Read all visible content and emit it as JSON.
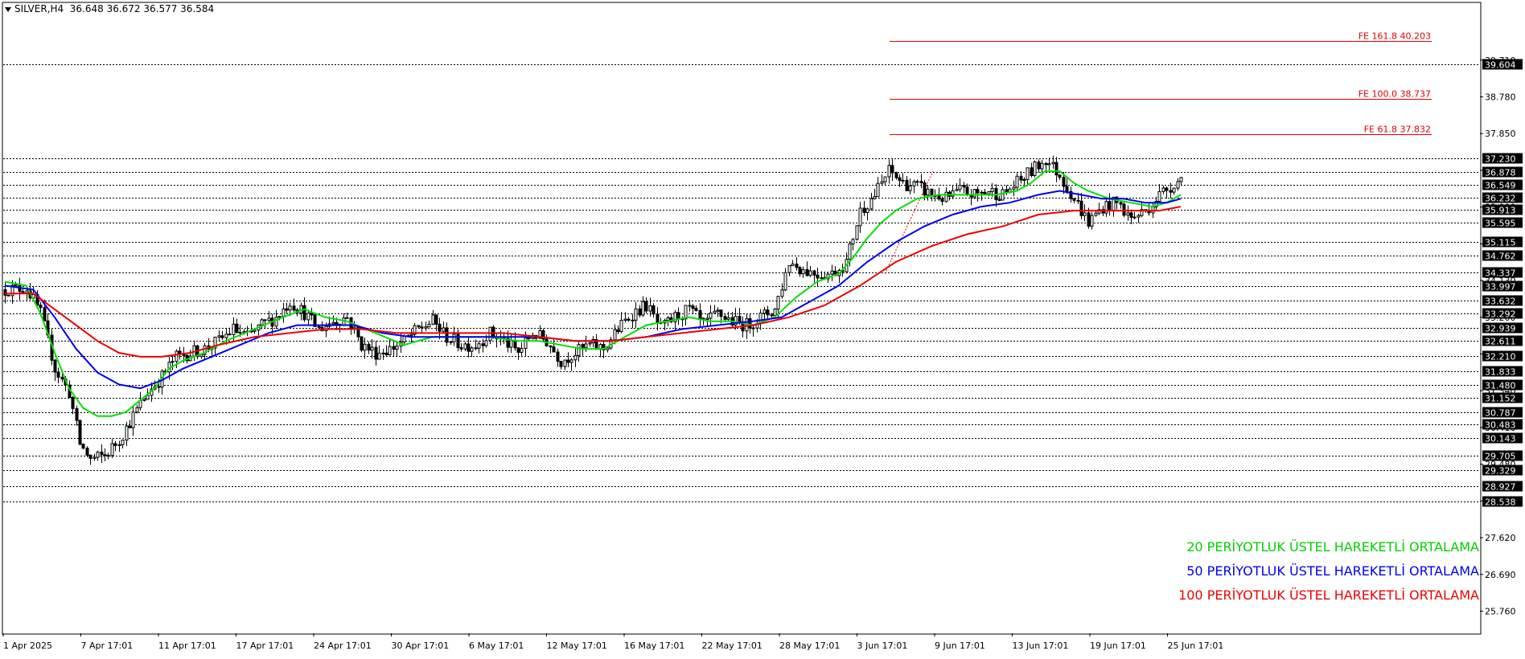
{
  "header": {
    "symbol": "SILVER,H4",
    "ohlc": "36.648 36.672 36.577 36.584"
  },
  "legend": [
    {
      "label": "20 PERİYOTLUK ÜSTEL HAREKETLİ ORTALAMA",
      "color": "#00e000"
    },
    {
      "label": "50 PERİYOTLUK ÜSTEL HAREKETLİ ORTALAMA",
      "color": "#0000ee"
    },
    {
      "label": "100 PERİYOTLUK ÜSTEL HAREKETLİ ORTALAMA",
      "color": "#ee0000"
    }
  ],
  "chart_data": {
    "type": "candlestick",
    "ylim": [
      25.2,
      41.15
    ],
    "y_ticks": [
      "39.710",
      "38.780",
      "37.850",
      "36.920",
      "35.990",
      "35.060",
      "34.130",
      "33.200",
      "32.270",
      "31.340",
      "30.410",
      "29.480",
      "28.550",
      "27.620",
      "26.690",
      "25.760"
    ],
    "x_ticks": [
      "1 Apr 2025",
      "7 Apr 17:01",
      "11 Apr 17:01",
      "17 Apr 17:01",
      "24 Apr 17:01",
      "30 Apr 17:01",
      "6 May 17:01",
      "12 May 17:01",
      "16 May 17:01",
      "22 May 17:01",
      "28 May 17:01",
      "3 Jun 17:01",
      "9 Jun 17:01",
      "13 Jun 17:01",
      "19 Jun 17:01",
      "25 Jun 17:01"
    ],
    "levels": [
      "39.604",
      "37.230",
      "36.878",
      "36.549",
      "36.232",
      "35.913",
      "35.595",
      "35.115",
      "34.762",
      "34.337",
      "33.997",
      "33.632",
      "33.292",
      "32.939",
      "32.611",
      "32.210",
      "31.833",
      "31.480",
      "31.152",
      "30.787",
      "30.483",
      "30.143",
      "29.705",
      "29.329",
      "28.927",
      "28.538"
    ],
    "fibonacci": [
      {
        "label": "FE 161.8 40.203",
        "value": 40.203
      },
      {
        "label": "FE 100.0 38.737",
        "value": 38.737
      },
      {
        "label": "FE 61.8 37.832",
        "value": 37.832
      }
    ],
    "anchors": [
      [
        0,
        33.9
      ],
      [
        6,
        33.95
      ],
      [
        10,
        33.3
      ],
      [
        14,
        31.9
      ],
      [
        18,
        31.3
      ],
      [
        21,
        30.0
      ],
      [
        24,
        29.6
      ],
      [
        28,
        29.7
      ],
      [
        32,
        30.1
      ],
      [
        36,
        30.7
      ],
      [
        40,
        31.3
      ],
      [
        44,
        31.7
      ],
      [
        48,
        32.2
      ],
      [
        52,
        32.3
      ],
      [
        56,
        32.4
      ],
      [
        60,
        32.6
      ],
      [
        64,
        32.9
      ],
      [
        68,
        32.7
      ],
      [
        72,
        33.0
      ],
      [
        76,
        33.2
      ],
      [
        80,
        33.6
      ],
      [
        84,
        33.3
      ],
      [
        88,
        32.9
      ],
      [
        92,
        33.1
      ],
      [
        96,
        33.2
      ],
      [
        100,
        32.5
      ],
      [
        104,
        32.3
      ],
      [
        108,
        32.4
      ],
      [
        112,
        32.6
      ],
      [
        116,
        32.9
      ],
      [
        120,
        33.1
      ],
      [
        124,
        32.7
      ],
      [
        128,
        32.5
      ],
      [
        132,
        32.5
      ],
      [
        136,
        32.8
      ],
      [
        140,
        32.6
      ],
      [
        144,
        32.3
      ],
      [
        148,
        32.8
      ],
      [
        152,
        32.6
      ],
      [
        156,
        32.1
      ],
      [
        160,
        32.3
      ],
      [
        164,
        32.5
      ],
      [
        168,
        32.4
      ],
      [
        172,
        32.9
      ],
      [
        176,
        33.3
      ],
      [
        180,
        33.5
      ],
      [
        184,
        32.9
      ],
      [
        188,
        33.2
      ],
      [
        192,
        33.4
      ],
      [
        196,
        33.0
      ],
      [
        200,
        33.3
      ],
      [
        204,
        33.1
      ],
      [
        208,
        33.0
      ],
      [
        212,
        33.2
      ],
      [
        216,
        33.4
      ],
      [
        220,
        34.6
      ],
      [
        224,
        34.4
      ],
      [
        228,
        34.3
      ],
      [
        232,
        34.3
      ],
      [
        236,
        34.6
      ],
      [
        240,
        35.9
      ],
      [
        244,
        36.3
      ],
      [
        248,
        36.9
      ],
      [
        252,
        36.6
      ],
      [
        256,
        36.5
      ],
      [
        260,
        36.3
      ],
      [
        264,
        36.2
      ],
      [
        268,
        36.4
      ],
      [
        272,
        36.3
      ],
      [
        276,
        36.4
      ],
      [
        280,
        36.3
      ],
      [
        284,
        36.6
      ],
      [
        288,
        36.9
      ],
      [
        292,
        37.2
      ],
      [
        296,
        36.8
      ],
      [
        300,
        36.2
      ],
      [
        304,
        35.6
      ],
      [
        308,
        36.0
      ],
      [
        312,
        36.1
      ],
      [
        316,
        35.7
      ],
      [
        320,
        35.9
      ],
      [
        324,
        36.3
      ],
      [
        328,
        36.6
      ],
      [
        330,
        36.7
      ]
    ],
    "ema": [
      {
        "name": "20",
        "color": "#00e000",
        "points": [
          [
            0,
            34.1
          ],
          [
            6,
            34.0
          ],
          [
            10,
            33.3
          ],
          [
            14,
            32.3
          ],
          [
            18,
            31.4
          ],
          [
            22,
            30.9
          ],
          [
            26,
            30.7
          ],
          [
            30,
            30.7
          ],
          [
            34,
            30.8
          ],
          [
            38,
            31.1
          ],
          [
            42,
            31.4
          ],
          [
            46,
            31.9
          ],
          [
            50,
            32.1
          ],
          [
            56,
            32.3
          ],
          [
            62,
            32.6
          ],
          [
            70,
            32.9
          ],
          [
            78,
            33.2
          ],
          [
            84,
            33.4
          ],
          [
            90,
            33.2
          ],
          [
            96,
            33.1
          ],
          [
            104,
            32.8
          ],
          [
            112,
            32.5
          ],
          [
            120,
            32.7
          ],
          [
            128,
            32.7
          ],
          [
            136,
            32.7
          ],
          [
            144,
            32.6
          ],
          [
            150,
            32.6
          ],
          [
            156,
            32.5
          ],
          [
            162,
            32.4
          ],
          [
            168,
            32.4
          ],
          [
            174,
            32.7
          ],
          [
            180,
            33.0
          ],
          [
            186,
            33.1
          ],
          [
            192,
            33.2
          ],
          [
            198,
            33.1
          ],
          [
            204,
            33.1
          ],
          [
            210,
            33.0
          ],
          [
            216,
            33.2
          ],
          [
            222,
            33.7
          ],
          [
            228,
            34.1
          ],
          [
            234,
            34.3
          ],
          [
            238,
            34.7
          ],
          [
            242,
            35.2
          ],
          [
            246,
            35.6
          ],
          [
            250,
            35.9
          ],
          [
            256,
            36.2
          ],
          [
            262,
            36.3
          ],
          [
            270,
            36.3
          ],
          [
            278,
            36.3
          ],
          [
            284,
            36.4
          ],
          [
            288,
            36.6
          ],
          [
            292,
            36.9
          ],
          [
            296,
            36.9
          ],
          [
            300,
            36.6
          ],
          [
            304,
            36.4
          ],
          [
            310,
            36.2
          ],
          [
            316,
            36.1
          ],
          [
            322,
            36.0
          ],
          [
            326,
            36.1
          ],
          [
            330,
            36.3
          ]
        ]
      },
      {
        "name": "50",
        "color": "#0000ee",
        "points": [
          [
            0,
            34.0
          ],
          [
            8,
            33.9
          ],
          [
            14,
            33.2
          ],
          [
            20,
            32.4
          ],
          [
            26,
            31.8
          ],
          [
            32,
            31.5
          ],
          [
            38,
            31.4
          ],
          [
            44,
            31.6
          ],
          [
            50,
            31.9
          ],
          [
            58,
            32.2
          ],
          [
            66,
            32.5
          ],
          [
            74,
            32.8
          ],
          [
            82,
            33.0
          ],
          [
            90,
            33.0
          ],
          [
            98,
            33.0
          ],
          [
            106,
            32.8
          ],
          [
            114,
            32.7
          ],
          [
            122,
            32.7
          ],
          [
            130,
            32.7
          ],
          [
            140,
            32.7
          ],
          [
            150,
            32.7
          ],
          [
            160,
            32.6
          ],
          [
            170,
            32.6
          ],
          [
            180,
            32.7
          ],
          [
            190,
            32.9
          ],
          [
            200,
            33.0
          ],
          [
            210,
            33.1
          ],
          [
            218,
            33.2
          ],
          [
            226,
            33.6
          ],
          [
            234,
            34.0
          ],
          [
            242,
            34.6
          ],
          [
            250,
            35.1
          ],
          [
            258,
            35.5
          ],
          [
            266,
            35.8
          ],
          [
            274,
            36.0
          ],
          [
            282,
            36.1
          ],
          [
            290,
            36.3
          ],
          [
            296,
            36.4
          ],
          [
            302,
            36.3
          ],
          [
            308,
            36.2
          ],
          [
            314,
            36.2
          ],
          [
            320,
            36.1
          ],
          [
            326,
            36.1
          ],
          [
            330,
            36.2
          ]
        ]
      },
      {
        "name": "100",
        "color": "#ee0000",
        "points": [
          [
            0,
            33.8
          ],
          [
            8,
            33.8
          ],
          [
            14,
            33.4
          ],
          [
            20,
            33.0
          ],
          [
            26,
            32.6
          ],
          [
            32,
            32.3
          ],
          [
            38,
            32.2
          ],
          [
            44,
            32.2
          ],
          [
            52,
            32.3
          ],
          [
            60,
            32.5
          ],
          [
            70,
            32.7
          ],
          [
            80,
            32.8
          ],
          [
            90,
            32.9
          ],
          [
            100,
            32.9
          ],
          [
            110,
            32.8
          ],
          [
            120,
            32.8
          ],
          [
            130,
            32.8
          ],
          [
            140,
            32.8
          ],
          [
            150,
            32.7
          ],
          [
            160,
            32.6
          ],
          [
            170,
            32.6
          ],
          [
            180,
            32.7
          ],
          [
            190,
            32.8
          ],
          [
            200,
            32.9
          ],
          [
            210,
            33.0
          ],
          [
            220,
            33.2
          ],
          [
            230,
            33.5
          ],
          [
            240,
            34.0
          ],
          [
            250,
            34.6
          ],
          [
            260,
            35.0
          ],
          [
            270,
            35.3
          ],
          [
            280,
            35.5
          ],
          [
            290,
            35.8
          ],
          [
            300,
            35.9
          ],
          [
            308,
            35.9
          ],
          [
            316,
            35.9
          ],
          [
            324,
            35.9
          ],
          [
            330,
            36.0
          ]
        ]
      }
    ]
  }
}
